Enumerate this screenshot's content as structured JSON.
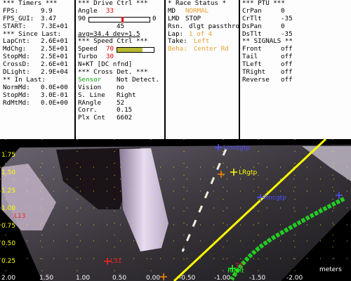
{
  "timers": {
    "title": "*** Timers ***",
    "rows": [
      {
        "label": "FPS:",
        "value": "9.9"
      },
      {
        "label": "FPS_GUI:",
        "value": "3.47"
      },
      {
        "label": "START:",
        "value": "7.3E+01"
      }
    ],
    "since_title": "*** Since Last:",
    "since_rows": [
      {
        "label": "LapCnt:",
        "value": "2.6E+01"
      },
      {
        "label": "MdChg:",
        "value": "2.5E+01"
      },
      {
        "label": "StopMd:",
        "value": "2.5E+01"
      },
      {
        "label": "CrossD:",
        "value": "2.6E+01"
      },
      {
        "label": "DLight:",
        "value": "2.9E+04"
      }
    ],
    "in_title": "** In Last:",
    "in_rows": [
      {
        "label": "NormMd:",
        "value": "0.0E+00"
      },
      {
        "label": "StopMd:",
        "value": "3.0E-01"
      },
      {
        "label": "RdMtMd:",
        "value": "0.0E+00"
      }
    ]
  },
  "drive": {
    "title": "***  Drive Ctrl  ***",
    "angle_label": "Angle",
    "angle_value": "33",
    "slider_min": "90",
    "slider_max": "0",
    "slider_level": 0.55,
    "mid_value": "45",
    "stats": "avg=34.4  dev=1.5",
    "speed_title": "***  Speed Ctrl  ***",
    "speed_label": "Speed",
    "speed_value": "70",
    "speed_level": 0.7,
    "turbo_label": "Turbo",
    "turbo_value": "30",
    "nkt": "N+KT [DC nfnd]",
    "cross_title": "*** Cross Det. ***",
    "sensor_label": "Sensor",
    "sensor_value": "Not Detect.",
    "vision_label": "Vision",
    "vision_value": "no",
    "sline_label": "S. Line",
    "sline_value": "Right",
    "rangle_label": "RAngle",
    "rangle_value": "52",
    "corr_label": "Corr.",
    "corr_value": "0.15",
    "plx_label": "Plx Cnt",
    "plx_value": "6602"
  },
  "race": {
    "title": "* Race Status *",
    "md_label": "MD",
    "md_value": "NORMAL",
    "lmd_label": "LMD",
    "lmd_value": "STOP",
    "rsn_label": "Rsn.",
    "rsn_value": "dlgt passthroDgh",
    "lap_label": "Lap:",
    "lap_value": "1 of 4",
    "take_label": "Take:",
    "take_value": "Left",
    "beha_label": "Beha:",
    "beha_value": "Center Rd"
  },
  "ptu": {
    "title": "*** PTU ***",
    "rows": [
      {
        "label": "CrPan",
        "value": "0"
      },
      {
        "label": "CrTlt",
        "value": "-35"
      },
      {
        "label": "DsPan",
        "value": "0"
      },
      {
        "label": "DsTlt",
        "value": "-35"
      }
    ],
    "signals_title": "** SIGNALS **",
    "signals": [
      {
        "label": "Front",
        "value": "off"
      },
      {
        "label": "Tail",
        "value": "off"
      },
      {
        "label": "TLeft",
        "value": "off"
      },
      {
        "label": "TRight",
        "value": "off"
      },
      {
        "label": "Reverse",
        "value": "off"
      }
    ]
  },
  "camera": {
    "y_ticks": [
      "1.75",
      "1.50",
      "1.25",
      "1.00",
      "0.75",
      "0.50",
      "0.25"
    ],
    "x_ticks": [
      "2.00",
      "1.50",
      "1.00",
      "0.50",
      "0.00",
      "-0.50",
      "-1.00",
      "-1.50",
      "-2.00"
    ],
    "units": "meters",
    "labels": {
      "lmntgtp": "Lmntgtp",
      "lrgtp": "LRgtp",
      "rncgtp": "Rncgtp",
      "left_red": "L13",
      "l31": "L31",
      "right_green": "Right",
      "right_num": "77"
    },
    "colors": {
      "grid": "#ffff00",
      "line": "#ffff00",
      "lane": "#22cc22",
      "marker_blue": "#5050ff",
      "marker_orange": "#ff8800",
      "marker_red": "#ff2020",
      "marker_green": "#20ff20"
    }
  }
}
